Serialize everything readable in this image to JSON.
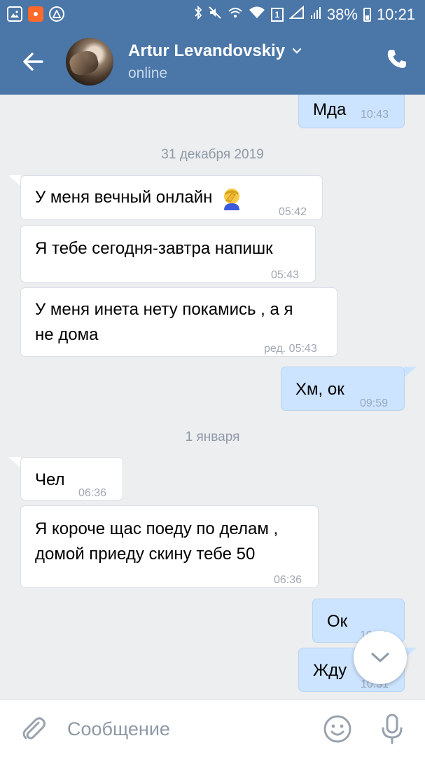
{
  "status_bar": {
    "battery": "38%",
    "time": "10:21",
    "sim_badge": "1"
  },
  "header": {
    "contact_name": "Artur Levandovskiy",
    "status": "online"
  },
  "messages": [
    {
      "dir": "out",
      "text": "Мда",
      "time": "10:43"
    },
    {
      "dir": "date",
      "text": "31 декабря 2019"
    },
    {
      "dir": "in",
      "text": "У меня вечный онлайн",
      "emoji": "facepalm",
      "time": "05:42"
    },
    {
      "dir": "in",
      "text": "Я тебе сегодня-завтра напишк",
      "time": "05:43"
    },
    {
      "dir": "in",
      "text_line1": "У меня инета нету покамись , а я",
      "text_line2": "не дома",
      "time": "ред. 05:43"
    },
    {
      "dir": "out",
      "text": "Хм, ок",
      "time": "09:59"
    },
    {
      "dir": "date",
      "text": "1 января"
    },
    {
      "dir": "in",
      "text": "Чел",
      "time": "06:36"
    },
    {
      "dir": "in",
      "text_line1": "Я короче щас поеду по делам ,",
      "text_line2": "домой приеду скину тебе 50",
      "time": "06:36"
    },
    {
      "dir": "out",
      "text": "Ок",
      "time": "10:30"
    },
    {
      "dir": "out",
      "text": "Жду",
      "time": "10:31"
    }
  ],
  "composer": {
    "placeholder": "Сообщение"
  },
  "colors": {
    "header_bg": "#4a76a8",
    "chat_bg": "#edeef0",
    "incoming_bubble": "#ffffff",
    "outgoing_bubble": "#cce4ff"
  }
}
